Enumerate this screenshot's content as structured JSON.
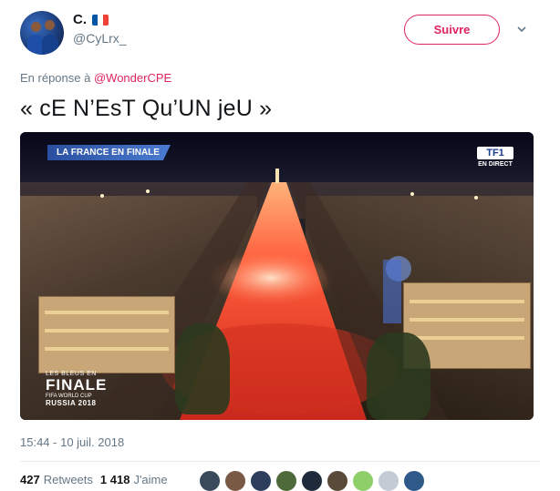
{
  "user": {
    "display_name": "C.",
    "handle": "@CyLrx_",
    "flag_colors": [
      "#0055a4",
      "#ffffff",
      "#ef4135"
    ]
  },
  "follow_button": {
    "label": "Suivre",
    "color": "#e0245e"
  },
  "reply": {
    "prefix": "En réponse à",
    "mention": "@WonderCPE"
  },
  "tweet": {
    "text": "« cE N’EsT Qu’UN jeU »",
    "timestamp": "15:44 - 10 juil. 2018"
  },
  "media": {
    "banner": "LA FRANCE EN FINALE",
    "channel_logo": "TF1",
    "channel_status": "EN DIRECT",
    "event_line1": "LES BLEUS EN",
    "event_line2": "FINALE",
    "event_line3": "FIFA WORLD CUP",
    "event_line4": "RUSSIA 2018"
  },
  "stats": {
    "retweets_count": "427",
    "retweets_label": "Retweets",
    "likes_count": "1 418",
    "likes_label": "J'aime"
  },
  "liker_avatars": [
    {
      "icon": "avatar-icon",
      "color": "#3b4a5a"
    },
    {
      "icon": "avatar-icon",
      "color": "#7a5a44"
    },
    {
      "icon": "avatar-icon",
      "color": "#2d3e5c"
    },
    {
      "icon": "avatar-icon",
      "color": "#4f6a3a"
    },
    {
      "icon": "avatar-icon",
      "color": "#1f2a3a"
    },
    {
      "icon": "avatar-icon",
      "color": "#5a4a3a"
    },
    {
      "icon": "avatar-icon",
      "color": "#8fcf6a"
    },
    {
      "icon": "default-avatar-icon",
      "color": "#c3ccd4"
    },
    {
      "icon": "avatar-icon",
      "color": "#2e5a8a"
    }
  ]
}
